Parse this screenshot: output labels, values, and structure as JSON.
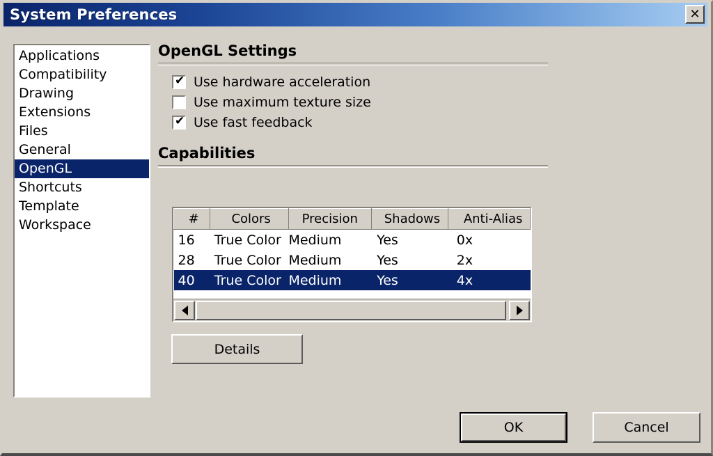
{
  "window": {
    "title": "System Preferences",
    "close_icon": "close-icon",
    "close_glyph": "✕",
    "titlebar_color_start": "#0a246a",
    "titlebar_color_end": "#a6cbf0",
    "face_color": "#d4d0c8",
    "selection_color": "#0a246a"
  },
  "sidebar": {
    "items": [
      {
        "label": "Applications",
        "selected": false
      },
      {
        "label": "Compatibility",
        "selected": false
      },
      {
        "label": "Drawing",
        "selected": false
      },
      {
        "label": "Extensions",
        "selected": false
      },
      {
        "label": "Files",
        "selected": false
      },
      {
        "label": "General",
        "selected": false
      },
      {
        "label": "OpenGL",
        "selected": true
      },
      {
        "label": "Shortcuts",
        "selected": false
      },
      {
        "label": "Template",
        "selected": false
      },
      {
        "label": "Workspace",
        "selected": false
      }
    ]
  },
  "opengl_settings": {
    "title": "OpenGL Settings",
    "checkboxes": [
      {
        "label": "Use hardware acceleration",
        "checked": true,
        "glyph": "✔"
      },
      {
        "label": "Use maximum texture size",
        "checked": false,
        "glyph": ""
      },
      {
        "label": "Use fast feedback",
        "checked": true,
        "glyph": "✔"
      }
    ]
  },
  "capabilities": {
    "title": "Capabilities",
    "columns": [
      "#",
      "Colors",
      "Precision",
      "Shadows",
      "Anti-Alias"
    ],
    "rows": [
      {
        "num": "16",
        "colors": "True Color",
        "precision": "Medium",
        "shadows": "Yes",
        "anti_alias": "0x",
        "selected": false
      },
      {
        "num": "28",
        "colors": "True Color",
        "precision": "Medium",
        "shadows": "Yes",
        "anti_alias": "2x",
        "selected": false
      },
      {
        "num": "40",
        "colors": "True Color",
        "precision": "Medium",
        "shadows": "Yes",
        "anti_alias": "4x",
        "selected": true
      }
    ],
    "scrollbar": {
      "left_arrow_icon": "triangle-left-icon",
      "right_arrow_icon": "triangle-right-icon"
    },
    "details_label": "Details"
  },
  "footer": {
    "ok_label": "OK",
    "cancel_label": "Cancel"
  }
}
